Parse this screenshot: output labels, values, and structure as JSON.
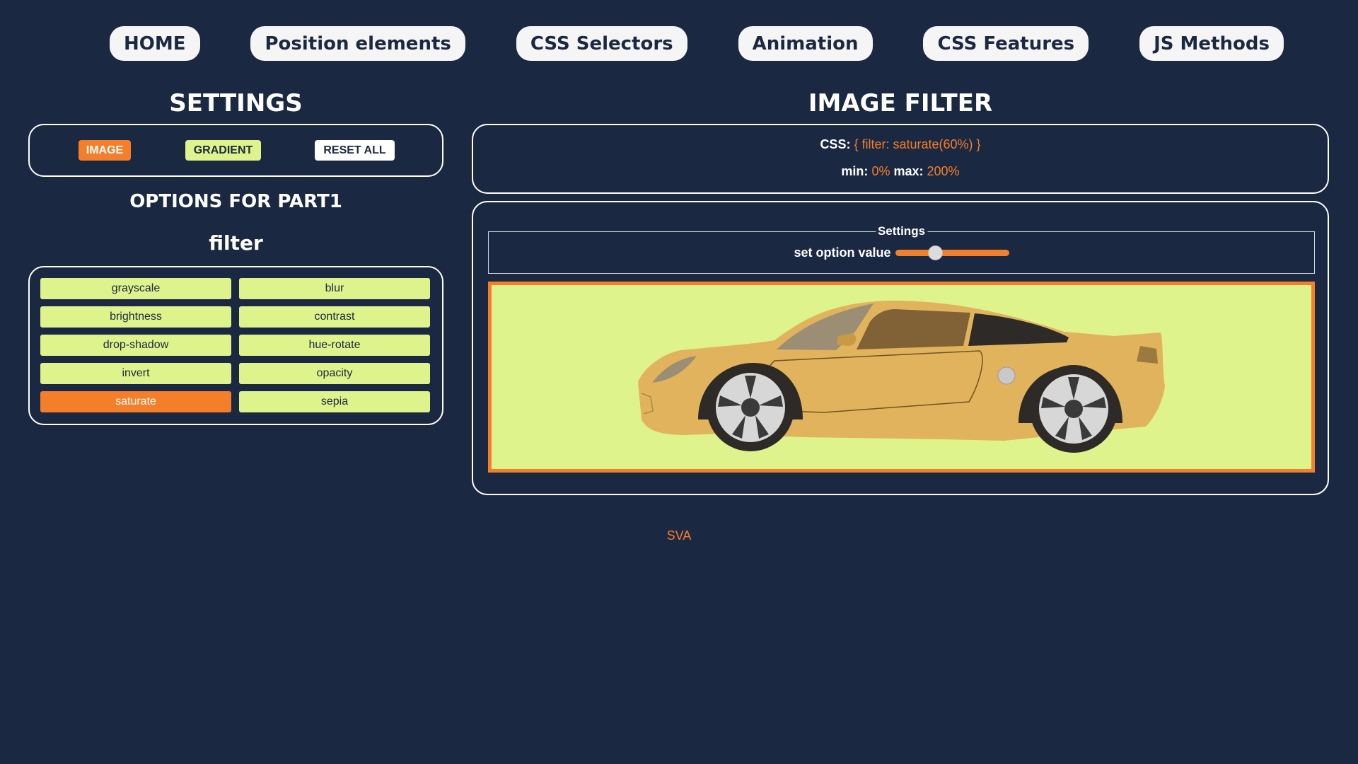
{
  "nav": {
    "items": [
      {
        "id": "home",
        "label": "HOME"
      },
      {
        "id": "position-elements",
        "label": "Position elements"
      },
      {
        "id": "css-selectors",
        "label": "CSS Selectors"
      },
      {
        "id": "animation",
        "label": "Animation"
      },
      {
        "id": "css-features",
        "label": "CSS Features"
      },
      {
        "id": "js-methods",
        "label": "JS Methods"
      }
    ]
  },
  "settings": {
    "title": "SETTINGS",
    "modes": {
      "image": "IMAGE",
      "gradient": "GRADIENT",
      "reset": "RESET ALL"
    },
    "active_mode": "IMAGE",
    "options_title": "OPTIONS FOR PART1",
    "filter_title": "filter",
    "filters": [
      "grayscale",
      "blur",
      "brightness",
      "contrast",
      "drop-shadow",
      "hue-rotate",
      "invert",
      "opacity",
      "saturate",
      "sepia"
    ],
    "active_filter": "saturate"
  },
  "image_filter": {
    "title": "IMAGE FILTER",
    "css_label": "CSS:",
    "css_value": "{ filter: saturate(60%) }",
    "min_label": "min:",
    "min_value": "0%",
    "max_label": "max:",
    "max_value": "200%",
    "fieldset_legend": "Settings",
    "slider_label": "set option value",
    "slider_value_percent": 60,
    "slider_min": 0,
    "slider_max": 200
  },
  "footer": {
    "text": "SVA"
  },
  "colors": {
    "background": "#1b2841",
    "accent": "#f47f2a",
    "button_light": "#def38b",
    "nav_button": "#f5f5f5",
    "car_body": "#e0b35c"
  }
}
